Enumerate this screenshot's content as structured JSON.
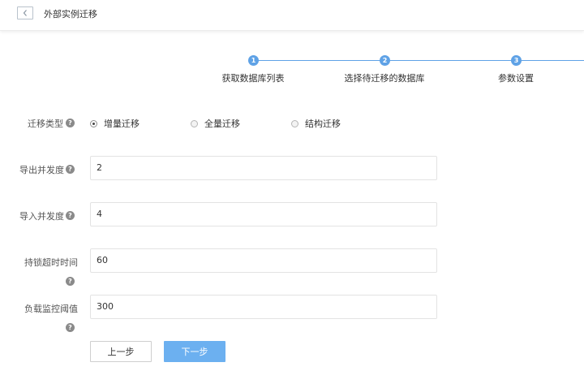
{
  "header": {
    "title": "外部实例迁移",
    "back_icon": "chevron-left-icon"
  },
  "steps": [
    {
      "number": "1",
      "label": "获取数据库列表"
    },
    {
      "number": "2",
      "label": "选择待迁移的数据库"
    },
    {
      "number": "3",
      "label": "参数设置"
    }
  ],
  "form": {
    "migration_type": {
      "label": "迁移类型",
      "options": [
        "增量迁移",
        "全量迁移",
        "结构迁移"
      ],
      "selected": "增量迁移"
    },
    "export_concurrency": {
      "label": "导出并发度",
      "value": "2"
    },
    "import_concurrency": {
      "label": "导入并发度",
      "value": "4"
    },
    "lock_timeout": {
      "label": "持锁超时时间",
      "value": "60"
    },
    "load_threshold": {
      "label": "负载监控阈值",
      "value": "300"
    },
    "help_icon": "?"
  },
  "buttons": {
    "prev": "上一步",
    "next": "下一步"
  },
  "colors": {
    "accent": "#5fa2e6",
    "primary_button": "#6cb0f0"
  }
}
